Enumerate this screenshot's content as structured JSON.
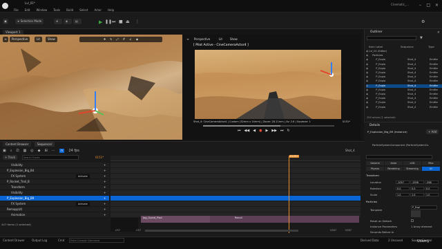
{
  "app": {
    "menus": [
      "File",
      "Edit",
      "Window",
      "Tools",
      "Build",
      "Select",
      "Actor",
      "Help"
    ],
    "level_tab": "Lvl_01*",
    "window_title": "Cinematic_..."
  },
  "toolbar": {
    "mode": "Selection Mode"
  },
  "viewport1": {
    "tab": "Viewport 1",
    "perspective": "Perspective",
    "lit": "Lit",
    "show": "Show"
  },
  "viewport2": {
    "perspective": "Perspective",
    "lit": "Lit",
    "show": "Show",
    "pilot": "[ Pilot Active - CineCameraActor4 ]",
    "info": "Shot_4: CineCameraActor4 | Custom (32mm x 14mm) | Zoom: 28.11mm | Av: 2.8 | Squeeze: 1",
    "frame": "0151*"
  },
  "sequencer": {
    "tabs": [
      "Content Browser",
      "Sequencer"
    ],
    "shot_label": "Shot_4",
    "fps": "24 fps",
    "add_track": "+ Track",
    "search_placeholder": "Search Tracks",
    "current_frame": "0151*",
    "playhead_label": "0155+",
    "tracks": [
      {
        "label": "Visibility",
        "indent": 2,
        "selected": false
      },
      {
        "label": "P_Explosion_Big_B4",
        "indent": 1,
        "selected": false
      },
      {
        "label": "FX System",
        "indent": 2,
        "selected": false,
        "extra": "Activate"
      },
      {
        "label": "P_Rocket_Trail_B",
        "indent": 1,
        "selected": false
      },
      {
        "label": "Transform",
        "indent": 2,
        "selected": false
      },
      {
        "label": "Visibility",
        "indent": 2,
        "selected": false
      },
      {
        "label": "P_Explosion_Big_B9",
        "indent": 1,
        "selected": true
      },
      {
        "label": "FX System",
        "indent": 2,
        "selected": false,
        "extra": "Activate"
      },
      {
        "label": "Remapp(d)",
        "indent": 1,
        "selected": false
      },
      {
        "label": "Animation",
        "indent": 2,
        "selected": false
      }
    ],
    "items_count": "447 items (1 selected)",
    "clip_left": "Jog_Guard_Pwd",
    "clip_right": "Recoil",
    "range_start": "-057",
    "range_mid": "-057",
    "range_end": "0367",
    "range_end2": "0367"
  },
  "outliner": {
    "title": "Outliner",
    "col_label": "Item Label",
    "col_type": "Type",
    "sequence_badge": "Sequence",
    "rows": [
      {
        "label": "Lvl_01 (Editor)",
        "type": "",
        "indent": 0,
        "selected": false
      },
      {
        "label": "Particles",
        "type": "",
        "indent": 1,
        "selected": false
      },
      {
        "label": "P_Explo",
        "type": "Emitte",
        "shot": "Shot_4",
        "indent": 2,
        "selected": false
      },
      {
        "label": "P_Explo",
        "type": "Emitte",
        "shot": "Shot_4",
        "indent": 2,
        "selected": false
      },
      {
        "label": "P_Explo",
        "type": "Emitte",
        "shot": "Shot_4",
        "indent": 2,
        "selected": false
      },
      {
        "label": "P_Explo",
        "type": "Emitte",
        "shot": "Shot_4",
        "indent": 2,
        "selected": false
      },
      {
        "label": "P_Explo",
        "type": "Emitte",
        "shot": "Shot_4",
        "indent": 2,
        "selected": false
      },
      {
        "label": "P_Explo",
        "type": "Emitte",
        "shot": "Shot_4",
        "indent": 2,
        "selected": false
      },
      {
        "label": "P_Explo",
        "type": "Emitte",
        "shot": "Shot_4",
        "indent": 2,
        "selected": true
      },
      {
        "label": "P_Explo",
        "type": "Emitte",
        "shot": "Shot_4",
        "indent": 2,
        "selected": false
      },
      {
        "label": "P_Explo",
        "type": "Emitte",
        "shot": "Shot_4",
        "indent": 2,
        "selected": false
      },
      {
        "label": "P_Explo",
        "type": "Emitte",
        "shot": "Shot_4",
        "indent": 2,
        "selected": false
      },
      {
        "label": "P_Explo",
        "type": "Emitte",
        "shot": "Shot_4",
        "indent": 2,
        "selected": false
      },
      {
        "label": "P_Explo",
        "type": "Emitte",
        "shot": "Shot_4",
        "indent": 2,
        "selected": false
      }
    ],
    "count": "250 actors (1 selected)"
  },
  "details": {
    "title": "Details",
    "object": "P_Explosion_Big_B9 (Instance)",
    "add": "+ Add",
    "component": "ParticleSystemComponent (ParticleSystemCo",
    "filters": [
      "General",
      "Actor",
      "LOD",
      "Misc",
      "Physics",
      "Rendering",
      "Streaming",
      "All"
    ],
    "transform_header": "Transform",
    "location": {
      "label": "Location",
      "x": "-1057",
      "y": "-1556",
      "z": "-598"
    },
    "rotation": {
      "label": "Rotation",
      "x": "0.0",
      "y": "0.0",
      "z": "0.0"
    },
    "scale": {
      "label": "Scale",
      "x": "1.0",
      "y": "1.0",
      "z": "1.0"
    },
    "particles_header": "Particles",
    "template_label": "Template",
    "template_value": "P_Expl",
    "reset_label": "Reset on Detach",
    "param_label": "Instance Parameters",
    "param_value": "1 Array element",
    "seconds_label": "Seconds Before In"
  },
  "statusbar": {
    "content_drawer": "Content Drawer",
    "output_log": "Output Log",
    "cmd": "Cmd",
    "console_placeholder": "Enter Console Command",
    "derived": "Derived Data",
    "unsaved": "2 Unsaved",
    "source": "Source Control"
  },
  "watermark": "Udemy"
}
